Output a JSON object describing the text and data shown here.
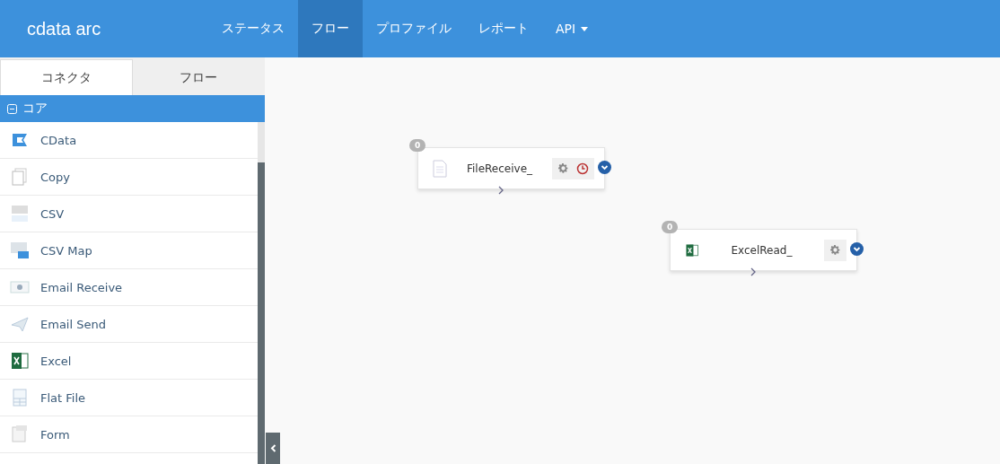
{
  "header": {
    "logo": "cdata arc",
    "nav": [
      {
        "label": "ステータス",
        "selected": false,
        "kind": "link"
      },
      {
        "label": "フロー",
        "selected": true,
        "kind": "link"
      },
      {
        "label": "プロファイル",
        "selected": false,
        "kind": "link"
      },
      {
        "label": "レポート",
        "selected": false,
        "kind": "link"
      },
      {
        "label": "API",
        "selected": false,
        "kind": "dropdown"
      }
    ]
  },
  "sidebar": {
    "tabs": [
      {
        "label": "コネクタ",
        "selected": true
      },
      {
        "label": "フロー",
        "selected": false
      }
    ],
    "group": {
      "label": "コア",
      "expanded": true
    },
    "items": [
      {
        "label": "CData",
        "kind": "cdata"
      },
      {
        "label": "Copy",
        "kind": "copy"
      },
      {
        "label": "CSV",
        "kind": "csv"
      },
      {
        "label": "CSV Map",
        "kind": "csvmap"
      },
      {
        "label": "Email Receive",
        "kind": "emailreceive"
      },
      {
        "label": "Email Send",
        "kind": "emailsend"
      },
      {
        "label": "Excel",
        "kind": "excel"
      },
      {
        "label": "Flat File",
        "kind": "flatfile"
      },
      {
        "label": "Form",
        "kind": "form"
      }
    ]
  },
  "canvas": {
    "nodes": [
      {
        "label": "FileReceive_",
        "count": "0",
        "kind": "file",
        "scheduled": true
      },
      {
        "label": "ExcelRead_",
        "count": "0",
        "kind": "excel",
        "scheduled": false
      }
    ]
  }
}
